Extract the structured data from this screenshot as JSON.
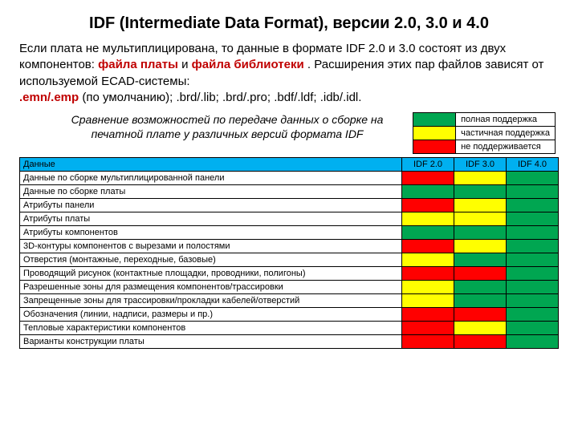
{
  "title": "IDF (Intermediate Data Format), версии 2.0, 3.0 и 4.0",
  "para": {
    "t1": "Если плата не мультиплицирована, то данные в формате IDF 2.0 и 3.0 состоят из двух компонентов: ",
    "h1": "файла платы",
    "t2": " и ",
    "h2": "файла библиотеки",
    "t3": ". Расширения этих пар файлов зависят от используемой ECAD-системы:",
    "ext_bold": ".emn/.emp",
    "ext_rest": " (по умолчанию); .brd/.lib; .brd/.pro; .bdf/.ldf; .idb/.idl."
  },
  "caption": "Сравнение возможностей по передаче данных о сборке на печатной плате у различных версий формата IDF",
  "legend": {
    "full": "полная поддержка",
    "partial": "частичная поддержка",
    "none": "не поддерживается"
  },
  "columns": {
    "data": "Данные",
    "c1": "IDF 2.0",
    "c2": "IDF 3.0",
    "c3": "IDF 4.0"
  },
  "rows": [
    {
      "label": "Данные по сборке мультиплицированной панели",
      "v": [
        "r",
        "y",
        "g"
      ]
    },
    {
      "label": "Данные по сборке платы",
      "v": [
        "g",
        "g",
        "g"
      ]
    },
    {
      "label": "Атрибуты панели",
      "v": [
        "r",
        "y",
        "g"
      ]
    },
    {
      "label": "Атрибуты платы",
      "v": [
        "y",
        "y",
        "g"
      ]
    },
    {
      "label": "Атрибуты компонентов",
      "v": [
        "g",
        "g",
        "g"
      ]
    },
    {
      "label": "3D-контуры компонентов с вырезами и полостями",
      "v": [
        "r",
        "y",
        "g"
      ]
    },
    {
      "label": "Отверстия (монтажные, переходные, базовые)",
      "v": [
        "y",
        "g",
        "g"
      ]
    },
    {
      "label": "Проводящий рисунок (контактные площадки, проводники, полигоны)",
      "v": [
        "r",
        "r",
        "g"
      ]
    },
    {
      "label": "Разрешенные зоны для размещения компонентов/трассировки",
      "v": [
        "y",
        "g",
        "g"
      ]
    },
    {
      "label": "Запрещенные зоны для трассировки/прокладки кабелей/отверстий",
      "v": [
        "y",
        "g",
        "g"
      ]
    },
    {
      "label": "Обозначения (линии, надписи, размеры и пр.)",
      "v": [
        "r",
        "r",
        "g"
      ]
    },
    {
      "label": "Тепловые характеристики компонентов",
      "v": [
        "r",
        "y",
        "g"
      ]
    },
    {
      "label": "Варианты конструкции платы",
      "v": [
        "r",
        "r",
        "g"
      ]
    }
  ]
}
